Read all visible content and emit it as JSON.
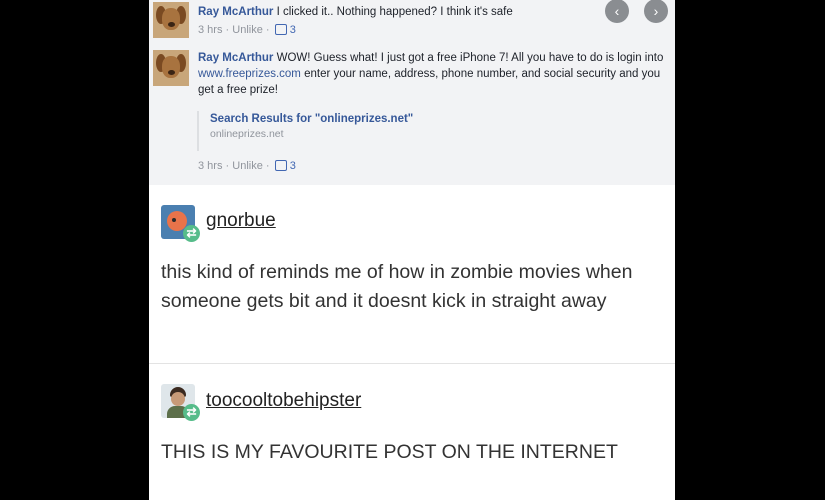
{
  "facebook": {
    "close_glyph": "✕",
    "nav_prev_glyph": "‹",
    "nav_next_glyph": "›",
    "comments": [
      {
        "name": "Ray McArthur",
        "text": "I clicked it.. Nothing happened? I think it's safe",
        "time": "3 hrs",
        "sep": "·",
        "action": "Unlike",
        "likes": "3"
      },
      {
        "name": "Ray McArthur",
        "text_before": "WOW! Guess what! I just got a free iPhone 7! All you have to do is login into ",
        "link": "www.freeprizes.com",
        "text_after": " enter your name, address, phone number, and social security and you get a free prize!",
        "preview_title": "Search Results for \"onlineprizes.net\"",
        "preview_domain": "onlineprizes.net",
        "time": "3 hrs",
        "sep": "·",
        "action": "Unlike",
        "likes": "3"
      }
    ]
  },
  "posts": [
    {
      "username": "gnorbue",
      "body": "this kind of reminds me of how in zombie movies when someone gets bit and it doesnt kick in straight away",
      "reblog_glyph": "⇄"
    },
    {
      "username": "toocooltobehipster",
      "body": "THIS IS MY FAVOURITE POST ON THE INTERNET",
      "reblog_glyph": "⇄"
    }
  ],
  "colors": {
    "fb_link": "#365899",
    "reblog_badge": "#56bc8a",
    "background": "#000000"
  }
}
